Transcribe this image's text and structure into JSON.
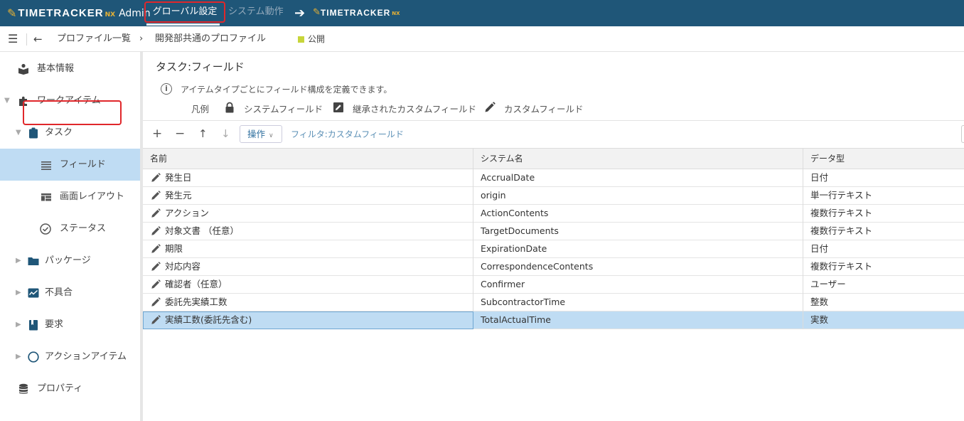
{
  "topbar": {
    "brand_name": "TIMETRACKER",
    "brand_suffix": "NX",
    "brand_admin": "Admin",
    "tab_global": "グローバル設定",
    "tab_system": "システム動作",
    "link_brand_name": "TIMETRACKER",
    "link_brand_suffix": "NX"
  },
  "subbar": {
    "breadcrumb_parent": "プロファイル一覧",
    "breadcrumb_current": "開発部共通のプロファイル",
    "status": "公開",
    "status_color": "#c7d53a"
  },
  "sidebar": {
    "items": [
      {
        "label": "基本情報",
        "icon": "book-reader-icon"
      },
      {
        "label": "ワークアイテム",
        "icon": "puzzle-icon"
      },
      {
        "label": "タスク",
        "icon": "clipboard-icon"
      },
      {
        "label": "フィールド",
        "icon": "list-lines-icon"
      },
      {
        "label": "画面レイアウト",
        "icon": "layout-icon"
      },
      {
        "label": "ステータス",
        "icon": "check-circle-icon"
      },
      {
        "label": "パッケージ",
        "icon": "folder-icon"
      },
      {
        "label": "不具合",
        "icon": "chart-line-icon"
      },
      {
        "label": "要求",
        "icon": "bookmark-book-icon"
      },
      {
        "label": "アクションアイテム",
        "icon": "circle-outline-icon"
      },
      {
        "label": "プロパティ",
        "icon": "database-icon"
      }
    ]
  },
  "main": {
    "title": "タスク:フィールド",
    "info": "アイテムタイプごとにフィールド構成を定義できます。",
    "legend_label": "凡例",
    "legend_system": "システムフィールド",
    "legend_inherited": "継承されたカスタムフィールド",
    "legend_custom": "カスタムフィールド"
  },
  "toolbar": {
    "add": "+",
    "remove": "−",
    "up": "↑",
    "down": "↓",
    "operations": "操作",
    "filter": "フィルタ:カスタムフィールド"
  },
  "table": {
    "headers": [
      "名前",
      "システム名",
      "データ型"
    ],
    "rows": [
      {
        "name": "発生日",
        "system_name": "AccrualDate",
        "type": "日付"
      },
      {
        "name": "発生元",
        "system_name": "origin",
        "type": "単一行テキスト"
      },
      {
        "name": "アクション",
        "system_name": "ActionContents",
        "type": "複数行テキスト"
      },
      {
        "name": "対象文書 （任意）",
        "system_name": "TargetDocuments",
        "type": "複数行テキスト"
      },
      {
        "name": "期限",
        "system_name": "ExpirationDate",
        "type": "日付"
      },
      {
        "name": "対応内容",
        "system_name": "CorrespondenceContents",
        "type": "複数行テキスト"
      },
      {
        "name": "確認者（任意）",
        "system_name": "Confirmer",
        "type": "ユーザー"
      },
      {
        "name": "委託先実績工数",
        "system_name": "SubcontractorTime",
        "type": "整数"
      },
      {
        "name": "実績工数(委託先含む)",
        "system_name": "TotalActualTime",
        "type": "実数"
      }
    ]
  },
  "colors": {
    "topbar": "#1f5678",
    "accent_gold": "#e8b233",
    "selection": "#bfdcf3",
    "highlight_red": "#e0272b"
  }
}
